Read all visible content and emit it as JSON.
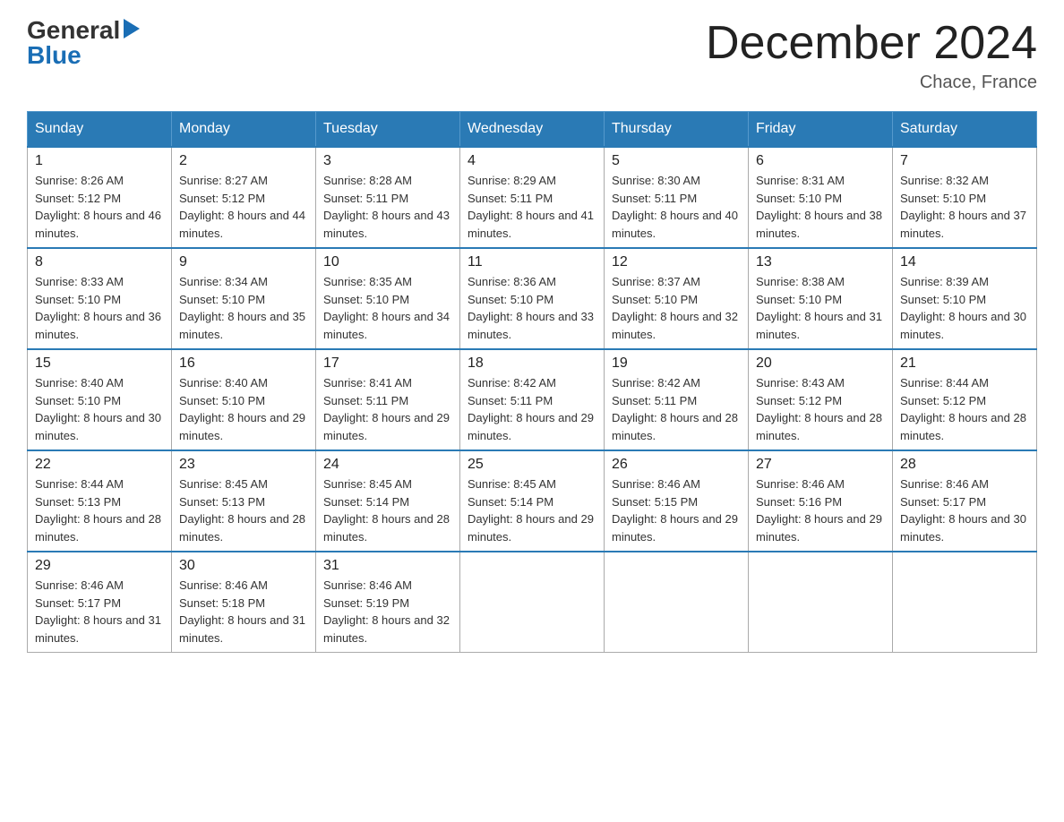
{
  "logo": {
    "general": "General",
    "blue": "Blue"
  },
  "title": "December 2024",
  "location": "Chace, France",
  "days_of_week": [
    "Sunday",
    "Monday",
    "Tuesday",
    "Wednesday",
    "Thursday",
    "Friday",
    "Saturday"
  ],
  "weeks": [
    [
      {
        "day": "1",
        "sunrise": "8:26 AM",
        "sunset": "5:12 PM",
        "daylight": "8 hours and 46 minutes."
      },
      {
        "day": "2",
        "sunrise": "8:27 AM",
        "sunset": "5:12 PM",
        "daylight": "8 hours and 44 minutes."
      },
      {
        "day": "3",
        "sunrise": "8:28 AM",
        "sunset": "5:11 PM",
        "daylight": "8 hours and 43 minutes."
      },
      {
        "day": "4",
        "sunrise": "8:29 AM",
        "sunset": "5:11 PM",
        "daylight": "8 hours and 41 minutes."
      },
      {
        "day": "5",
        "sunrise": "8:30 AM",
        "sunset": "5:11 PM",
        "daylight": "8 hours and 40 minutes."
      },
      {
        "day": "6",
        "sunrise": "8:31 AM",
        "sunset": "5:10 PM",
        "daylight": "8 hours and 38 minutes."
      },
      {
        "day": "7",
        "sunrise": "8:32 AM",
        "sunset": "5:10 PM",
        "daylight": "8 hours and 37 minutes."
      }
    ],
    [
      {
        "day": "8",
        "sunrise": "8:33 AM",
        "sunset": "5:10 PM",
        "daylight": "8 hours and 36 minutes."
      },
      {
        "day": "9",
        "sunrise": "8:34 AM",
        "sunset": "5:10 PM",
        "daylight": "8 hours and 35 minutes."
      },
      {
        "day": "10",
        "sunrise": "8:35 AM",
        "sunset": "5:10 PM",
        "daylight": "8 hours and 34 minutes."
      },
      {
        "day": "11",
        "sunrise": "8:36 AM",
        "sunset": "5:10 PM",
        "daylight": "8 hours and 33 minutes."
      },
      {
        "day": "12",
        "sunrise": "8:37 AM",
        "sunset": "5:10 PM",
        "daylight": "8 hours and 32 minutes."
      },
      {
        "day": "13",
        "sunrise": "8:38 AM",
        "sunset": "5:10 PM",
        "daylight": "8 hours and 31 minutes."
      },
      {
        "day": "14",
        "sunrise": "8:39 AM",
        "sunset": "5:10 PM",
        "daylight": "8 hours and 30 minutes."
      }
    ],
    [
      {
        "day": "15",
        "sunrise": "8:40 AM",
        "sunset": "5:10 PM",
        "daylight": "8 hours and 30 minutes."
      },
      {
        "day": "16",
        "sunrise": "8:40 AM",
        "sunset": "5:10 PM",
        "daylight": "8 hours and 29 minutes."
      },
      {
        "day": "17",
        "sunrise": "8:41 AM",
        "sunset": "5:11 PM",
        "daylight": "8 hours and 29 minutes."
      },
      {
        "day": "18",
        "sunrise": "8:42 AM",
        "sunset": "5:11 PM",
        "daylight": "8 hours and 29 minutes."
      },
      {
        "day": "19",
        "sunrise": "8:42 AM",
        "sunset": "5:11 PM",
        "daylight": "8 hours and 28 minutes."
      },
      {
        "day": "20",
        "sunrise": "8:43 AM",
        "sunset": "5:12 PM",
        "daylight": "8 hours and 28 minutes."
      },
      {
        "day": "21",
        "sunrise": "8:44 AM",
        "sunset": "5:12 PM",
        "daylight": "8 hours and 28 minutes."
      }
    ],
    [
      {
        "day": "22",
        "sunrise": "8:44 AM",
        "sunset": "5:13 PM",
        "daylight": "8 hours and 28 minutes."
      },
      {
        "day": "23",
        "sunrise": "8:45 AM",
        "sunset": "5:13 PM",
        "daylight": "8 hours and 28 minutes."
      },
      {
        "day": "24",
        "sunrise": "8:45 AM",
        "sunset": "5:14 PM",
        "daylight": "8 hours and 28 minutes."
      },
      {
        "day": "25",
        "sunrise": "8:45 AM",
        "sunset": "5:14 PM",
        "daylight": "8 hours and 29 minutes."
      },
      {
        "day": "26",
        "sunrise": "8:46 AM",
        "sunset": "5:15 PM",
        "daylight": "8 hours and 29 minutes."
      },
      {
        "day": "27",
        "sunrise": "8:46 AM",
        "sunset": "5:16 PM",
        "daylight": "8 hours and 29 minutes."
      },
      {
        "day": "28",
        "sunrise": "8:46 AM",
        "sunset": "5:17 PM",
        "daylight": "8 hours and 30 minutes."
      }
    ],
    [
      {
        "day": "29",
        "sunrise": "8:46 AM",
        "sunset": "5:17 PM",
        "daylight": "8 hours and 31 minutes."
      },
      {
        "day": "30",
        "sunrise": "8:46 AM",
        "sunset": "5:18 PM",
        "daylight": "8 hours and 31 minutes."
      },
      {
        "day": "31",
        "sunrise": "8:46 AM",
        "sunset": "5:19 PM",
        "daylight": "8 hours and 32 minutes."
      },
      null,
      null,
      null,
      null
    ]
  ]
}
